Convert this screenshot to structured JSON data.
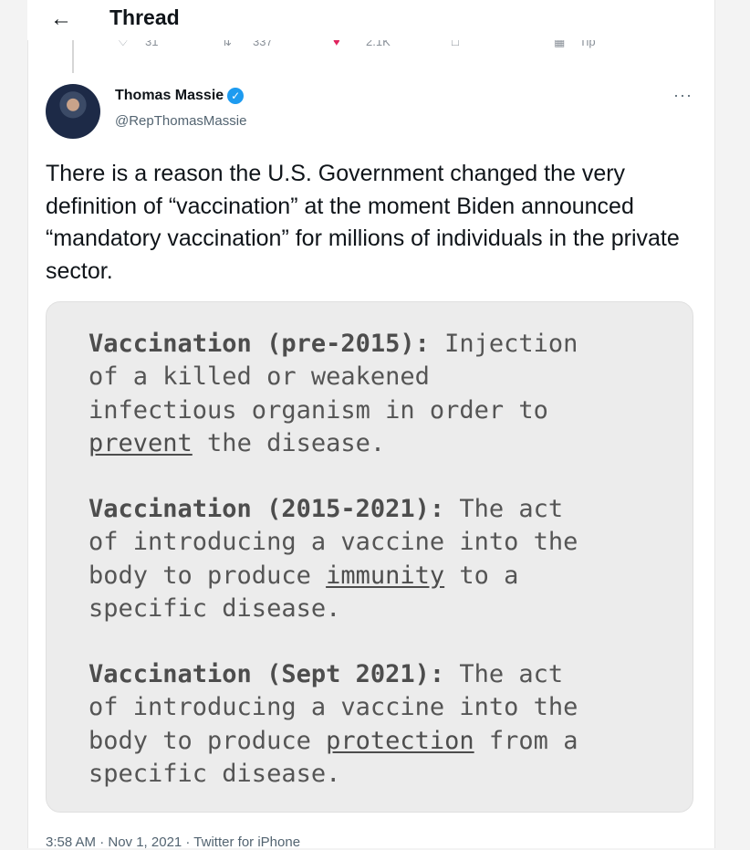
{
  "header": {
    "back_icon": "arrow-left-icon",
    "title": "Thread"
  },
  "prev_actions": {
    "reply_count": "31",
    "retweet_count": "337",
    "like_count": "2.1K",
    "tip_label": "Tip"
  },
  "tweet": {
    "author": {
      "name": "Thomas Massie",
      "handle": "@RepThomasMassie",
      "verified": true
    },
    "more_label": "···",
    "text": "There is a reason the U.S. Government changed the very definition of “vaccination” at the moment Biden announced “mandatory vaccination” for millions of individuals in the private sector.",
    "image": {
      "definitions": [
        {
          "term": "Vaccination (pre-2015):",
          "text_before": " Injection\nof a killed or weakened\ninfectious organism in order to\n",
          "keyword": "prevent",
          "text_after": " the disease."
        },
        {
          "term": "Vaccination (2015-2021):",
          "text_before": " The act\nof introducing a vaccine into the\nbody to produce ",
          "keyword": "immunity",
          "text_after": " to a\nspecific disease."
        },
        {
          "term": "Vaccination (Sept 2021):",
          "text_before": " The act\nof introducing a vaccine into the\nbody to produce ",
          "keyword": "protection",
          "text_after": " from a\nspecific disease."
        }
      ]
    },
    "timestamp": "3:58 AM · Nov 1, 2021 · Twitter for iPhone"
  },
  "colors": {
    "verified_badge": "#1d9bf0",
    "like_heart": "#e0245e",
    "media_bg": "#ececec"
  }
}
